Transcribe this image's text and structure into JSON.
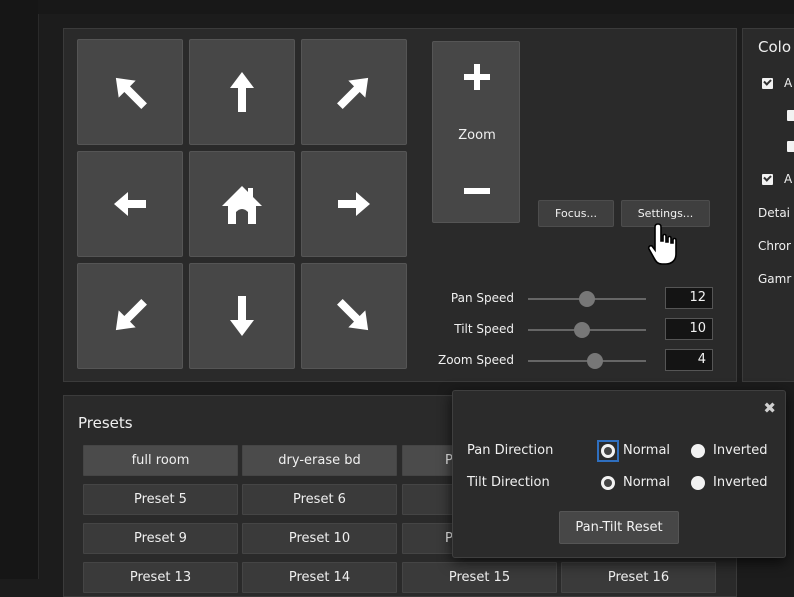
{
  "ptz": {
    "zoom_label": "Zoom",
    "focus_label": "Focus...",
    "settings_label": "Settings...",
    "speeds": [
      {
        "label": "Pan Speed",
        "value": "12",
        "level": 0.5
      },
      {
        "label": "Tilt Speed",
        "value": "10",
        "level": 0.46
      },
      {
        "label": "Zoom Speed",
        "value": "4",
        "level": 0.57
      }
    ]
  },
  "color": {
    "title": "Colo",
    "checkbox_1": "A",
    "checkbox_2": "A",
    "detail": "Detai",
    "chroma": "Chror",
    "gamma": "Gamr"
  },
  "presets": {
    "title": "Presets",
    "items": [
      "full room",
      "dry-erase bd",
      "P",
      "Preset 5",
      "Preset 6",
      "Preset 9",
      "Preset 10",
      "P",
      "Preset 13",
      "Preset 14",
      "Preset 15",
      "Preset 16"
    ]
  },
  "popup": {
    "pan_label": "Pan Direction",
    "tilt_label": "Tilt Direction",
    "normal": "Normal",
    "inverted": "Inverted",
    "reset_label": "Pan-Tilt Reset",
    "close_glyph": "✖"
  },
  "colors": {
    "accent": "#2f6fbf",
    "button": "#474747",
    "panel": "#2a2a2a"
  }
}
